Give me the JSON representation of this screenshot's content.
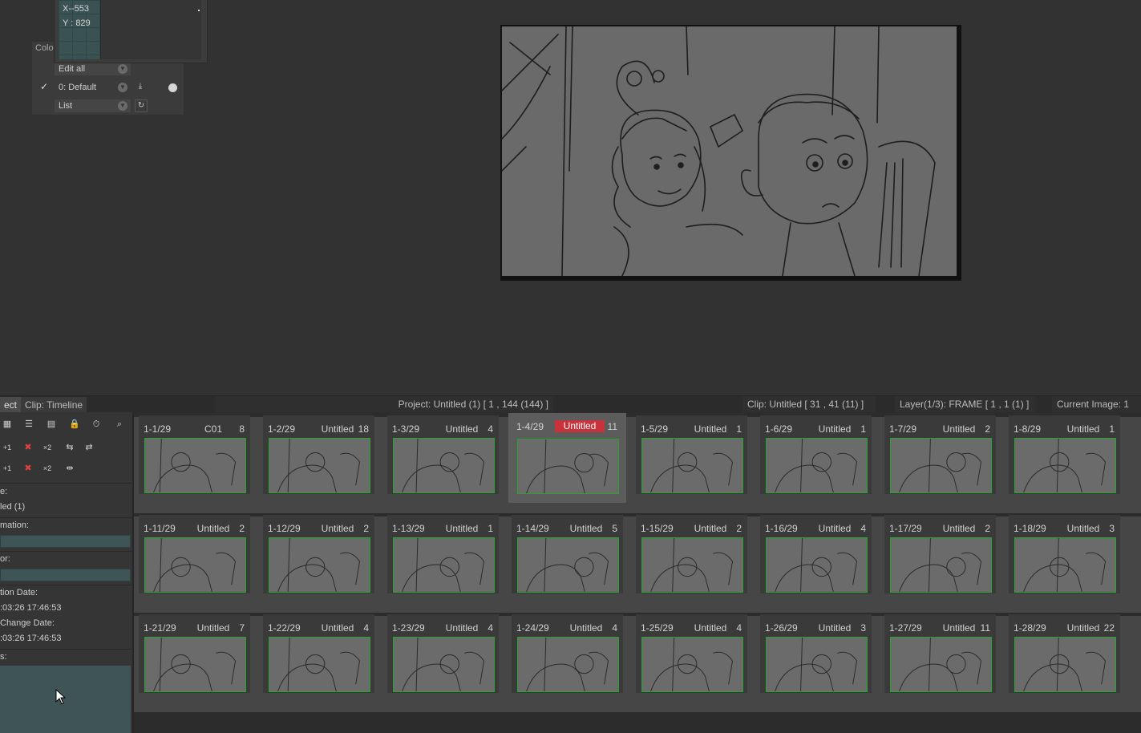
{
  "coord_panel": {
    "x_label": "X",
    "x_value": "-553",
    "y_label": "Y",
    "y_value": "829",
    "panel_tab": "Colo"
  },
  "layer_panel": {
    "edit_mode": "Edit all",
    "layer": "0: Default",
    "view_mode": "List"
  },
  "status": {
    "tab_left": "ect",
    "tab_clip": "Clip: Timeline",
    "project": "Project: Untitled (1) [ 1 , 144  (144) ]",
    "clip": "Clip: Untitled [ 31 , 41  (11) ]",
    "layer": "Layer(1/3): FRAME [ 1 , 1  (1) ]",
    "current_image": "Current Image: 1"
  },
  "info_panel": {
    "name_label": "e:",
    "name_value": "led (1)",
    "information_label": "mation:",
    "author_label": "or:",
    "creation_label": "tion Date:",
    "creation_value": ":03:26 17:46:53",
    "change_label": "Change Date:",
    "change_value": ":03:26 17:46:53",
    "notes_label": "s:"
  },
  "clips": [
    [
      {
        "id": "1-1/29",
        "name": "C01",
        "count": "8"
      },
      {
        "id": "1-2/29",
        "name": "Untitled",
        "count": "18"
      },
      {
        "id": "1-3/29",
        "name": "Untitled",
        "count": "4"
      },
      {
        "id": "1-4/29",
        "name": "Untitled",
        "count": "11",
        "current": true
      },
      {
        "id": "1-5/29",
        "name": "Untitled",
        "count": "1"
      },
      {
        "id": "1-6/29",
        "name": "Untitled",
        "count": "1"
      },
      {
        "id": "1-7/29",
        "name": "Untitled",
        "count": "2"
      },
      {
        "id": "1-8/29",
        "name": "Untitled",
        "count": "1"
      }
    ],
    [
      {
        "id": "1-11/29",
        "name": "Untitled",
        "count": "2"
      },
      {
        "id": "1-12/29",
        "name": "Untitled",
        "count": "2"
      },
      {
        "id": "1-13/29",
        "name": "Untitled",
        "count": "1"
      },
      {
        "id": "1-14/29",
        "name": "Untitled",
        "count": "5"
      },
      {
        "id": "1-15/29",
        "name": "Untitled",
        "count": "2"
      },
      {
        "id": "1-16/29",
        "name": "Untitled",
        "count": "4"
      },
      {
        "id": "1-17/29",
        "name": "Untitled",
        "count": "2"
      },
      {
        "id": "1-18/29",
        "name": "Untitled",
        "count": "3"
      }
    ],
    [
      {
        "id": "1-21/29",
        "name": "Untitled",
        "count": "7"
      },
      {
        "id": "1-22/29",
        "name": "Untitled",
        "count": "4"
      },
      {
        "id": "1-23/29",
        "name": "Untitled",
        "count": "4"
      },
      {
        "id": "1-24/29",
        "name": "Untitled",
        "count": "4"
      },
      {
        "id": "1-25/29",
        "name": "Untitled",
        "count": "4"
      },
      {
        "id": "1-26/29",
        "name": "Untitled",
        "count": "3"
      },
      {
        "id": "1-27/29",
        "name": "Untitled",
        "count": "11"
      },
      {
        "id": "1-28/29",
        "name": "Untitled",
        "count": "22"
      }
    ]
  ],
  "colors": {
    "current_clip": "#c8323a",
    "thumb_border": "#27a52b"
  }
}
